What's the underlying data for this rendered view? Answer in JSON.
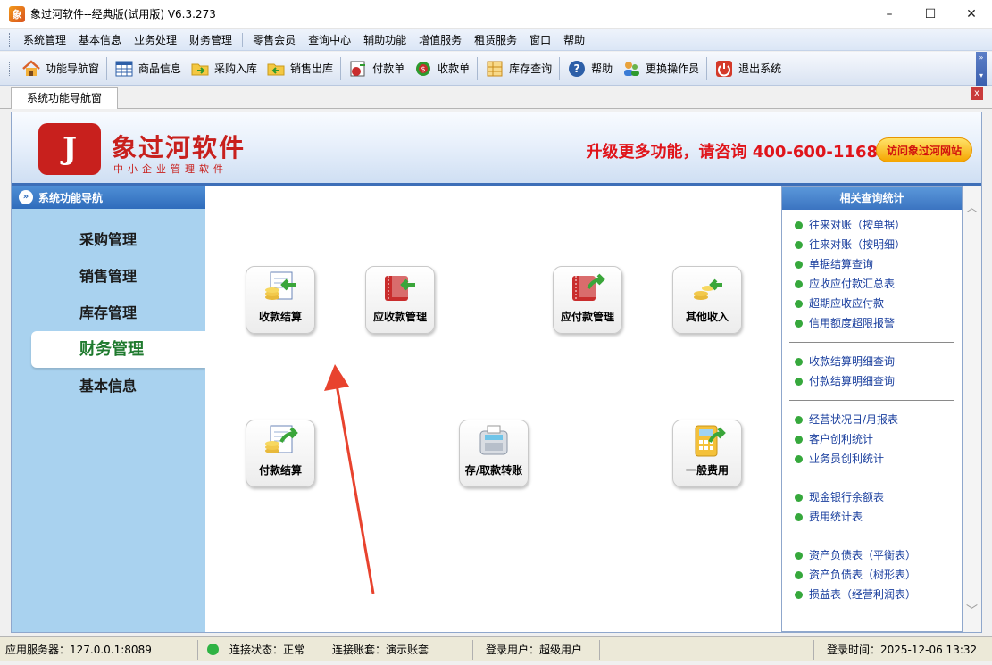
{
  "window": {
    "title": "象过河软件--经典版(试用版) V6.3.273",
    "app_icon_text": "象",
    "minimize": "–",
    "maximize": "☐",
    "close": "✕"
  },
  "menu": [
    "系统管理",
    "基本信息",
    "业务处理",
    "财务管理",
    "零售会员",
    "查询中心",
    "辅助功能",
    "增值服务",
    "租赁服务",
    "窗口",
    "帮助"
  ],
  "toolbar": [
    {
      "label": "功能导航窗",
      "icon": "home-icon"
    },
    {
      "label": "商品信息",
      "icon": "grid-icon"
    },
    {
      "label": "采购入库",
      "icon": "folder-arrow-icon"
    },
    {
      "label": "销售出库",
      "icon": "folder-arrow-icon"
    },
    {
      "label": "付款单",
      "icon": "payment-icon"
    },
    {
      "label": "收款单",
      "icon": "receipt-icon"
    },
    {
      "label": "库存查询",
      "icon": "inventory-icon"
    },
    {
      "label": "帮助",
      "icon": "help-icon"
    },
    {
      "label": "更换操作员",
      "icon": "users-icon"
    },
    {
      "label": "退出系统",
      "icon": "power-icon"
    }
  ],
  "tab": {
    "label": "系统功能导航窗",
    "close": "x"
  },
  "banner": {
    "logo_mark": "J",
    "brand_name": "象过河软件",
    "brand_sub": "中小企业管理软件",
    "promo": "升级更多功能，请咨询 400-600-1168",
    "visit_button": "访问象过河网站"
  },
  "nav": {
    "header": "系统功能导航",
    "items": [
      "采购管理",
      "销售管理",
      "库存管理",
      "财务管理",
      "基本信息"
    ],
    "active": "财务管理"
  },
  "functions": [
    {
      "label": "收款结算",
      "icon": "coins-arrow-icon"
    },
    {
      "label": "应收款管理",
      "icon": "book-arrow-icon"
    },
    {
      "label": "应付款管理",
      "icon": "book-arrow-icon"
    },
    {
      "label": "其他收入",
      "icon": "coins-icon"
    },
    {
      "label": "付款结算",
      "icon": "coins-arrow-icon"
    },
    {
      "label": "存/取款转账",
      "icon": "pos-terminal-icon"
    },
    {
      "label": "一般费用",
      "icon": "calculator-icon"
    }
  ],
  "related": {
    "header": "相关查询统计",
    "groups": [
      [
        "往来对账（按单据）",
        "往来对账（按明细）",
        "单据结算查询",
        "应收应付款汇总表",
        "超期应收应付款",
        "信用额度超限报警"
      ],
      [
        "收款结算明细查询",
        "付款结算明细查询"
      ],
      [
        "经营状况日/月报表",
        "客户创利统计",
        "业务员创利统计"
      ],
      [
        "现金银行余额表",
        "费用统计表"
      ],
      [
        "资产负债表（平衡表）",
        "资产负债表（树形表）",
        "损益表（经营利润表）"
      ]
    ]
  },
  "status": {
    "server": "应用服务器：127.0.0.1:8089",
    "connection": "连接状态：正常",
    "account_set": "连接账套：演示账套",
    "user": "登录用户：超级用户",
    "login_time": "登录时间：2025-12-06 13:32"
  },
  "colors": {
    "brand_red": "#c8201d",
    "promo_red": "#e0141a",
    "nav_bg": "#a9d2ef",
    "link_blue": "#1a3f9e",
    "status_green": "#2fb344"
  }
}
